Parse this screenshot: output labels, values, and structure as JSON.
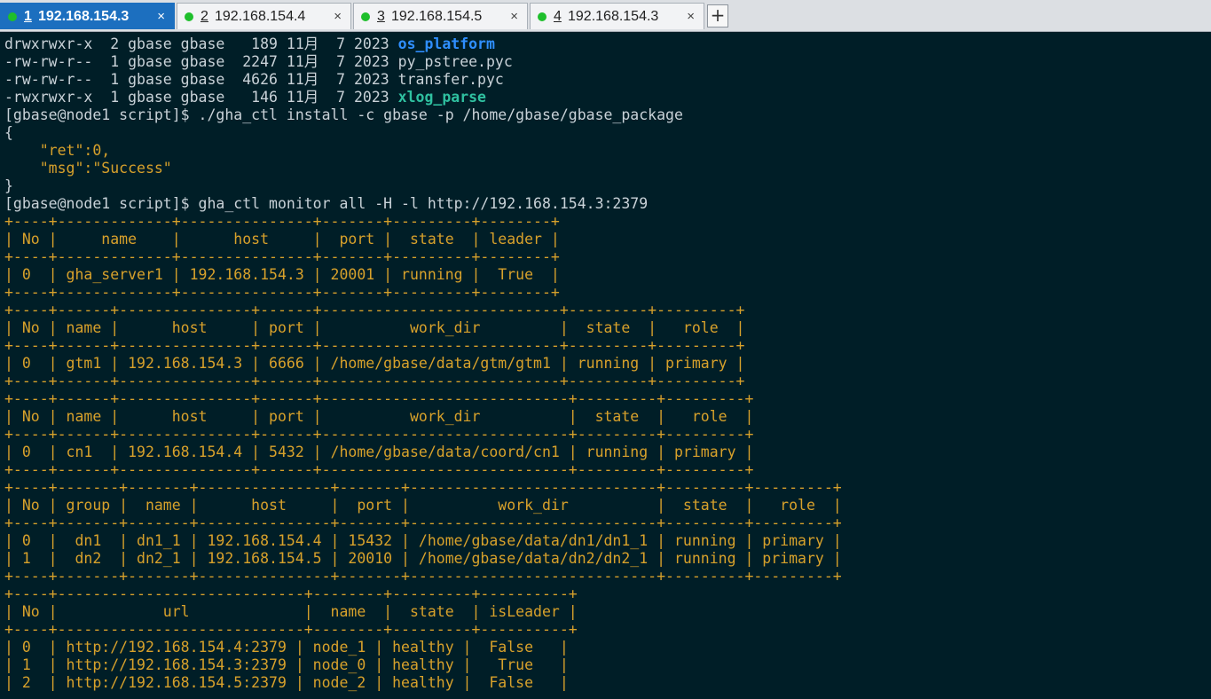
{
  "tabs": [
    {
      "number": "1",
      "host": "192.168.154.3",
      "close": "×",
      "status_color": "#1fbf2c",
      "active": true
    },
    {
      "number": "2",
      "host": "192.168.154.4",
      "close": "×",
      "status_color": "#1fbf2c",
      "active": false
    },
    {
      "number": "3",
      "host": "192.168.154.5",
      "close": "×",
      "status_color": "#1fbf2c",
      "active": false
    },
    {
      "number": "4",
      "host": "192.168.154.3",
      "close": "×",
      "status_color": "#1fbf2c",
      "active": false
    }
  ],
  "new_tab_label": "+",
  "terminal": {
    "lines": [
      [
        "drwxrwxr-x  2 gbase gbase   189 11月  7 2023 ",
        "os_platform"
      ],
      [
        "-rw-rw-r--  1 gbase gbase  2247 11月  7 2023 py_pstree.pyc"
      ],
      [
        "-rw-rw-r--  1 gbase gbase  4626 11月  7 2023 transfer.pyc"
      ],
      [
        "-rwxrwxr-x  1 gbase gbase   146 11月  7 2023 ",
        "xlog_parse"
      ],
      [
        "[gbase@node1 script]$ ./gha_ctl install -c gbase -p /home/gbase/gbase_package"
      ],
      [
        "{"
      ],
      [
        "    \"ret\":0,"
      ],
      [
        "    \"msg\":\"Success\""
      ],
      [
        "}"
      ],
      [
        "[gbase@node1 script]$ gha_ctl monitor all -H -l http://192.168.154.3:2379"
      ],
      [
        "+----+-------------+---------------+-------+---------+--------+"
      ],
      [
        "| No |     name    |      host     |  port |  state  | leader |"
      ],
      [
        "+----+-------------+---------------+-------+---------+--------+"
      ],
      [
        "| 0  | gha_server1 | 192.168.154.3 | 20001 | running |  True  |"
      ],
      [
        "+----+-------------+---------------+-------+---------+--------+"
      ],
      [
        "+----+------+---------------+------+---------------------------+---------+---------+"
      ],
      [
        "| No | name |      host     | port |          work_dir         |  state  |   role  |"
      ],
      [
        "+----+------+---------------+------+---------------------------+---------+---------+"
      ],
      [
        "| 0  | gtm1 | 192.168.154.3 | 6666 | /home/gbase/data/gtm/gtm1 | running | primary |"
      ],
      [
        "+----+------+---------------+------+---------------------------+---------+---------+"
      ],
      [
        "+----+------+---------------+------+----------------------------+---------+---------+"
      ],
      [
        "| No | name |      host     | port |          work_dir          |  state  |   role  |"
      ],
      [
        "+----+------+---------------+------+----------------------------+---------+---------+"
      ],
      [
        "| 0  | cn1  | 192.168.154.4 | 5432 | /home/gbase/data/coord/cn1 | running | primary |"
      ],
      [
        "+----+------+---------------+------+----------------------------+---------+---------+"
      ],
      [
        "+----+-------+-------+---------------+-------+----------------------------+---------+---------+"
      ],
      [
        "| No | group |  name |      host     |  port |          work_dir          |  state  |   role  |"
      ],
      [
        "+----+-------+-------+---------------+-------+----------------------------+---------+---------+"
      ],
      [
        "| 0  |  dn1  | dn1_1 | 192.168.154.4 | 15432 | /home/gbase/data/dn1/dn1_1 | running | primary |"
      ],
      [
        "| 1  |  dn2  | dn2_1 | 192.168.154.5 | 20010 | /home/gbase/data/dn2/dn2_1 | running | primary |"
      ],
      [
        "+----+-------+-------+---------------+-------+----------------------------+---------+---------+"
      ],
      [
        "+----+----------------------------+--------+---------+----------+"
      ],
      [
        "| No |            url             |  name  |  state  | isLeader |"
      ],
      [
        "+----+----------------------------+--------+---------+----------+"
      ],
      [
        "| 0  | http://192.168.154.4:2379 | node_1 | healthy |  False   |"
      ],
      [
        "| 1  | http://192.168.154.3:2379 | node_0 | healthy |   True   |"
      ],
      [
        "| 2  | http://192.168.154.5:2379 | node_2 | healthy |  False   |"
      ]
    ]
  },
  "colors": {
    "terminal_bg": "#001e27",
    "plain_text": "#c9d2d8",
    "table_text": "#d7a12b",
    "directory": "#2f8fff",
    "executable": "#2fc0a0",
    "active_tab": "#1c6fbf",
    "status_dot": "#1fbf2c"
  }
}
